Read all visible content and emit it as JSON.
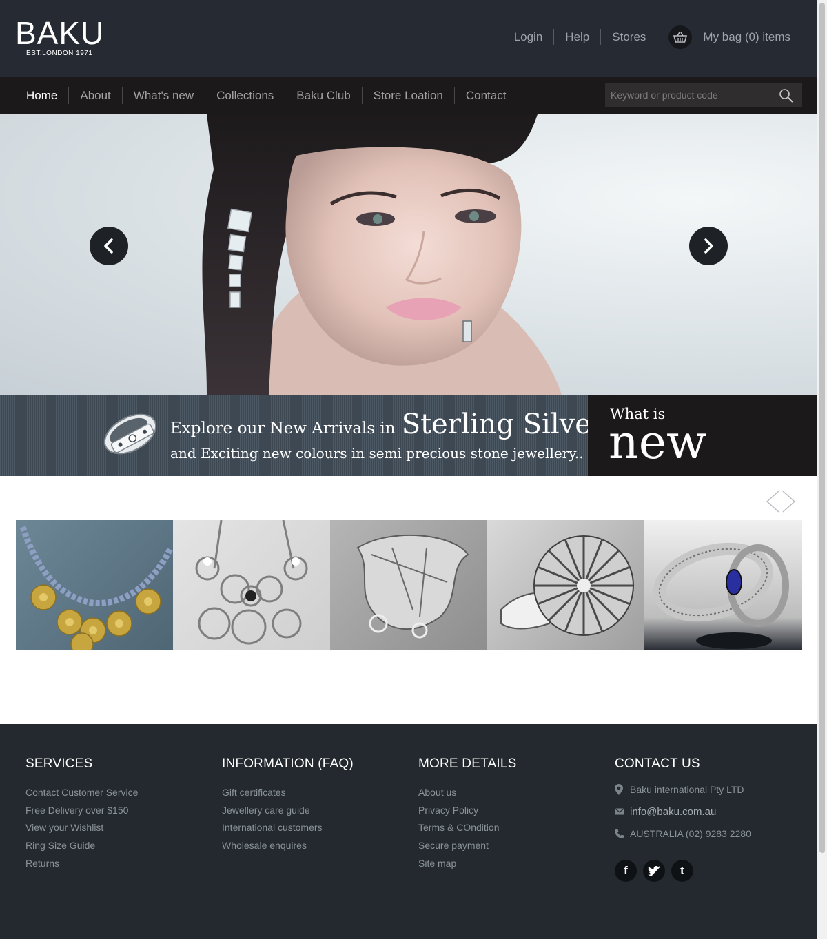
{
  "header": {
    "logo_word": "BAKU",
    "logo_sub": "EST.LONDON 1971",
    "links": [
      "Login",
      "Help",
      "Stores"
    ],
    "bag_text": "My bag (0) items"
  },
  "nav": {
    "items": [
      "Home",
      "About",
      "What's new",
      "Collections",
      "Baku Club",
      "Store Loation",
      "Contact"
    ],
    "search_placeholder": "Keyword or product code"
  },
  "promo": {
    "line1_small": "Explore our New Arrivals in",
    "line1_big": "Sterling Silver",
    "line2": "and Exciting new colours in semi precious stone jewellery..",
    "what_is": "What is",
    "new": "new"
  },
  "gallery": {
    "items": [
      "gold-flower-necklace",
      "silver-circles-necklace",
      "silver-leaf-brooch",
      "silver-sunburst-ring",
      "sapphire-twist-ring"
    ]
  },
  "footer": {
    "services": {
      "title": "SERVICES",
      "links": [
        "Contact Customer Service",
        "Free Delivery over $150",
        "View your Wishlist",
        "Ring Size Guide",
        "Returns"
      ]
    },
    "information": {
      "title": "INFORMATION (FAQ)",
      "links": [
        "Gift certificates",
        "Jewellery care guide",
        "International customers",
        "Wholesale enquires"
      ]
    },
    "more_details": {
      "title": "MORE DETAILS",
      "links": [
        "About us",
        "Privacy Policy",
        "Terms & COndition",
        "Secure payment",
        "Site map"
      ]
    },
    "contact": {
      "title": "CONTACT US",
      "company": "Baku international Pty LTD",
      "email": "info@baku.com.au",
      "phone": "AUSTRALIA (02) 9283 2280"
    },
    "socials": [
      "facebook-icon",
      "twitter-icon",
      "tumblr-icon"
    ]
  },
  "colors": {
    "header_bg": "#262a33",
    "nav_bg": "#1c191a",
    "footer_bg": "#23292e"
  }
}
